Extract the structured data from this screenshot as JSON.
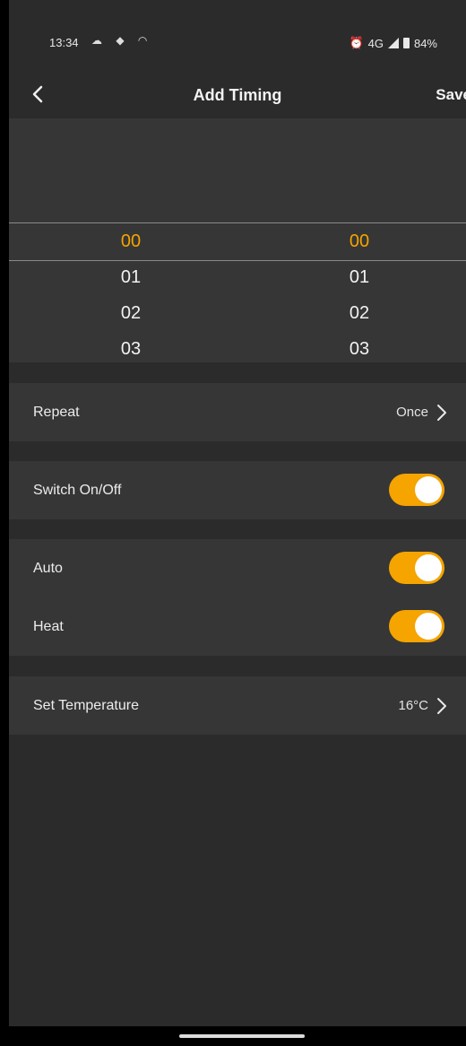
{
  "status": {
    "time": "13:34",
    "network": "4G",
    "battery": "84%"
  },
  "nav": {
    "title": "Add Timing",
    "save_label": "Save"
  },
  "picker": {
    "hours": [
      "00",
      "01",
      "02",
      "03"
    ],
    "minutes": [
      "00",
      "01",
      "02",
      "03"
    ],
    "selected_hour": "00",
    "selected_minute": "00"
  },
  "rows": {
    "repeat": {
      "label": "Repeat",
      "value": "Once"
    },
    "switch": {
      "label": "Switch On/Off",
      "on": true
    },
    "auto": {
      "label": "Auto",
      "on": true
    },
    "heat": {
      "label": "Heat",
      "on": true
    },
    "temperature": {
      "label": "Set Temperature",
      "value": "16°C"
    }
  },
  "colors": {
    "accent": "#f5a400",
    "background": "#2b2b2b",
    "card": "#363636"
  }
}
